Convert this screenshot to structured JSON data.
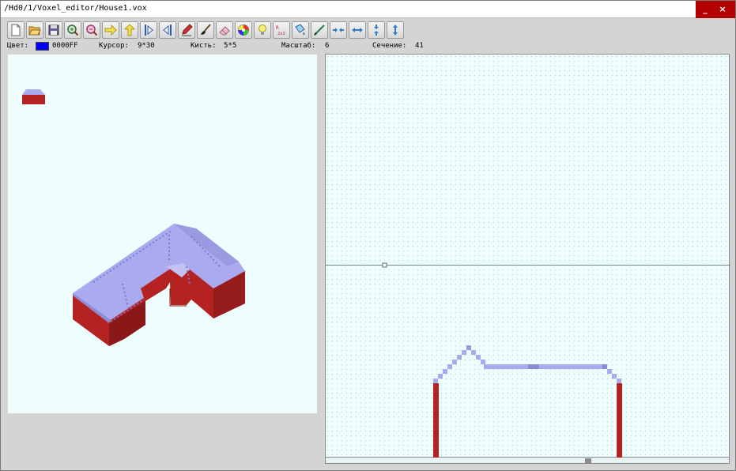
{
  "window": {
    "title": "/Hd0/1/Voxel_editor/House1.vox",
    "minimize_label": "_",
    "close_label": "×"
  },
  "toolbar": {
    "buttons": [
      {
        "name": "new-file",
        "icon": "new-file-icon"
      },
      {
        "name": "open-file",
        "icon": "folder-open-icon"
      },
      {
        "name": "save-file",
        "icon": "floppy-save-icon"
      },
      {
        "name": "zoom-in",
        "icon": "zoom-in-icon"
      },
      {
        "name": "zoom-out",
        "icon": "zoom-out-icon"
      },
      {
        "name": "arrow-right",
        "icon": "arrow-right-icon"
      },
      {
        "name": "arrow-up",
        "icon": "arrow-up-icon"
      },
      {
        "name": "mirror-left",
        "icon": "mirror-left-icon"
      },
      {
        "name": "mirror-right",
        "icon": "mirror-right-icon"
      },
      {
        "name": "pencil",
        "icon": "pencil-icon"
      },
      {
        "name": "brush",
        "icon": "brush-icon"
      },
      {
        "name": "eraser",
        "icon": "eraser-icon"
      },
      {
        "name": "palette",
        "icon": "color-palette-icon"
      },
      {
        "name": "light",
        "icon": "light-bulb-icon"
      },
      {
        "name": "scale-2x2",
        "icon": "scale-2x2-icon",
        "text": "2x2"
      },
      {
        "name": "fill",
        "icon": "fill-bucket-icon"
      },
      {
        "name": "draw-line",
        "icon": "draw-line-icon"
      },
      {
        "name": "shift-horizontal-in",
        "icon": "compress-horizontal-icon"
      },
      {
        "name": "shift-horizontal-out",
        "icon": "expand-horizontal-icon"
      },
      {
        "name": "shift-vertical-in",
        "icon": "compress-vertical-icon"
      },
      {
        "name": "shift-vertical-out",
        "icon": "expand-vertical-icon"
      }
    ]
  },
  "status": {
    "color_label": "Цвет:",
    "color_value": "0000FF",
    "color_hex": "#0000ff",
    "cursor_label": "Курсор:",
    "cursor_value": "9*30",
    "brush_label": "Кисть:",
    "brush_value": "5*5",
    "scale_label": "Масштаб:",
    "scale_value": "6",
    "section_label": "Сечение:",
    "section_value": "41"
  },
  "colors": {
    "wall": "#b42222",
    "roof": "#aaaaee",
    "roof_dark": "#7a7acc",
    "grid_dot": "#a9c9c9",
    "canvas_bg": "#eefefe"
  }
}
